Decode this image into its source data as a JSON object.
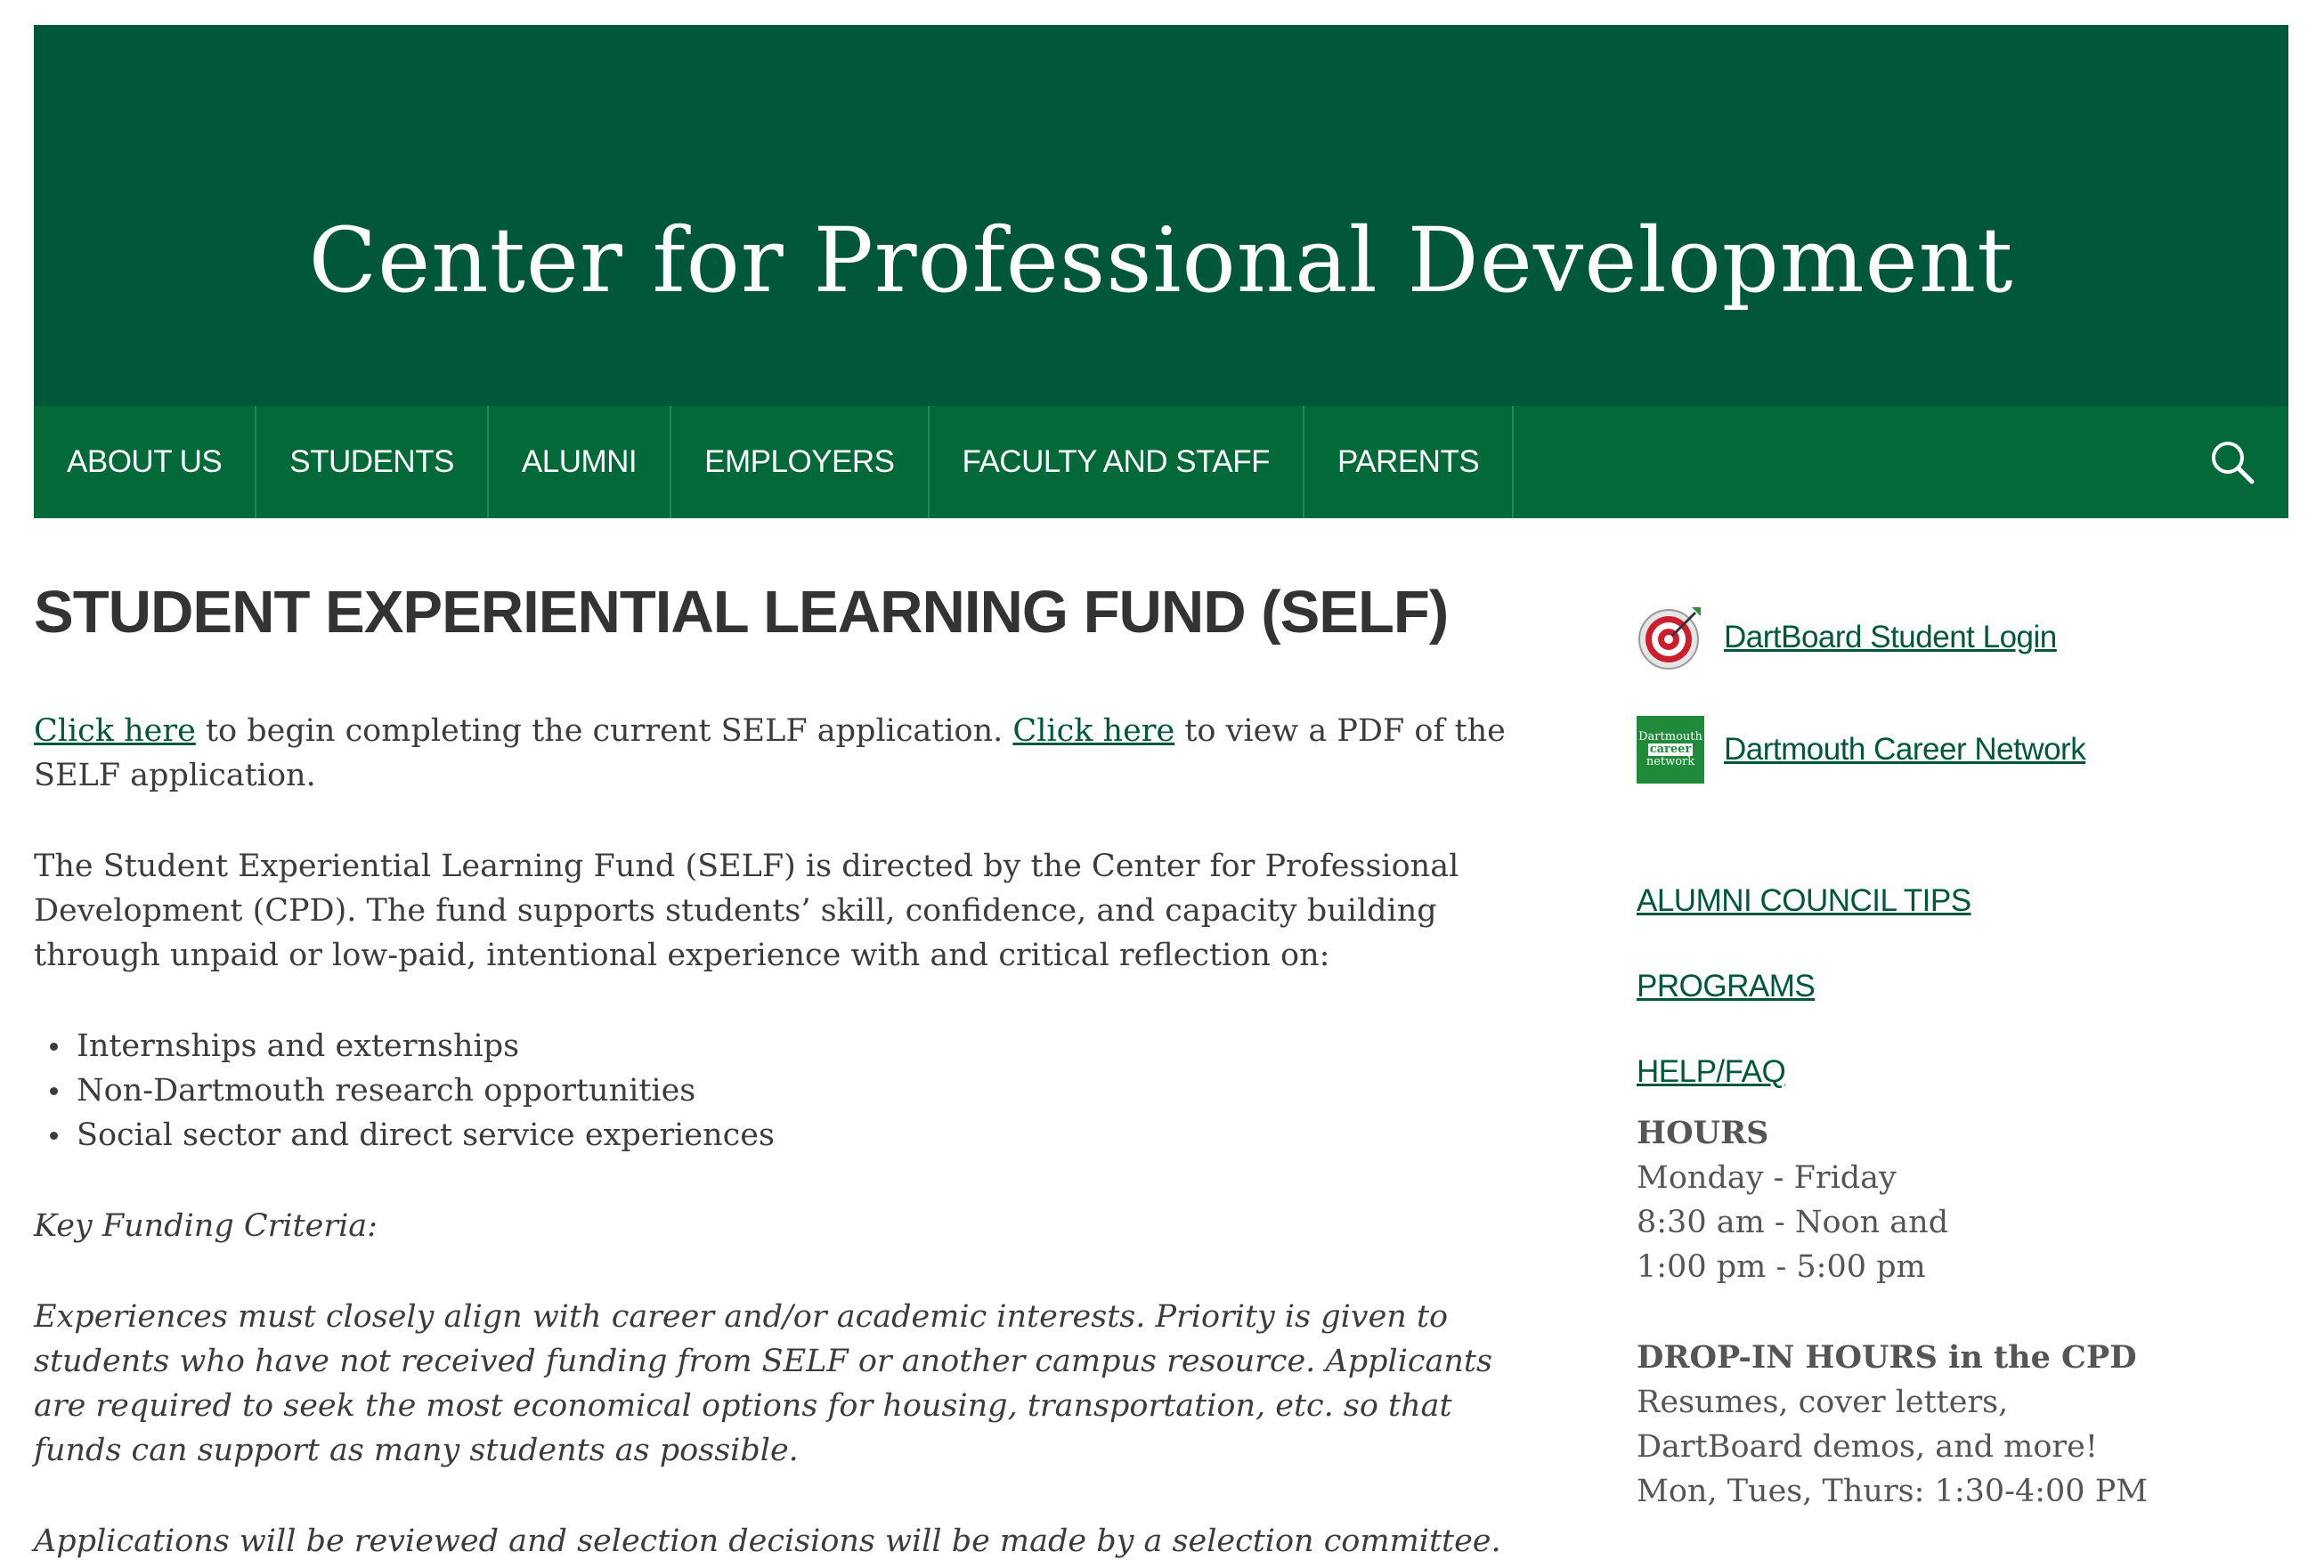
{
  "header": {
    "site_title": "Center for Professional Development"
  },
  "nav": {
    "items": [
      {
        "label": "ABOUT US"
      },
      {
        "label": "STUDENTS"
      },
      {
        "label": "ALUMNI"
      },
      {
        "label": "EMPLOYERS"
      },
      {
        "label": "FACULTY AND STAFF"
      },
      {
        "label": "PARENTS"
      }
    ],
    "search_icon": "search-icon"
  },
  "main": {
    "title": "STUDENT EXPERIENTIAL LEARNING FUND (SELF)",
    "intro": {
      "link1": "Click here",
      "text1": " to begin completing the current SELF application. ",
      "link2": "Click here",
      "text2": " to view a PDF of the SELF application."
    },
    "description": "The Student Experiential Learning Fund (SELF) is directed by the Center for Professional Development (CPD). The fund supports students’ skill, confidence, and capacity building through unpaid or low-paid, intentional experience with and critical reflection on:",
    "bullets": [
      "Internships and externships",
      "Non-Dartmouth research opportunities",
      "Social sector and direct service experiences"
    ],
    "criteria_heading": "Key Funding Criteria:",
    "criteria_text": "Experiences must closely align with career and/or academic interests. Priority is given to students who have not received funding from SELF or another campus resource. Applicants are required to seek the most economical options for housing, transportation, etc. so that funds can support as many students as possible.",
    "review_text": "Applications will be reviewed and selection decisions will be made by a selection committee."
  },
  "sidebar": {
    "dartboard_link": "DartBoard Student Login",
    "dcn_link": "Dartmouth Career Network",
    "dcn_logo_lines": [
      "Dartmouth",
      "career",
      "network"
    ],
    "links": [
      "ALUMNI COUNCIL TIPS",
      "PROGRAMS",
      "HELP/FAQ"
    ],
    "hours": {
      "heading": "HOURS",
      "lines": [
        "Monday - Friday",
        "8:30 am - Noon and",
        "1:00 pm - 5:00 pm"
      ]
    },
    "dropin": {
      "heading": "DROP-IN HOURS in the CPD",
      "lines": [
        "Resumes, cover letters,",
        "DartBoard demos, and more!",
        "Mon, Tues, Thurs: 1:30-4:00 PM"
      ]
    }
  },
  "colors": {
    "banner": "#00573a",
    "nav": "#036939",
    "link": "#00573a"
  }
}
